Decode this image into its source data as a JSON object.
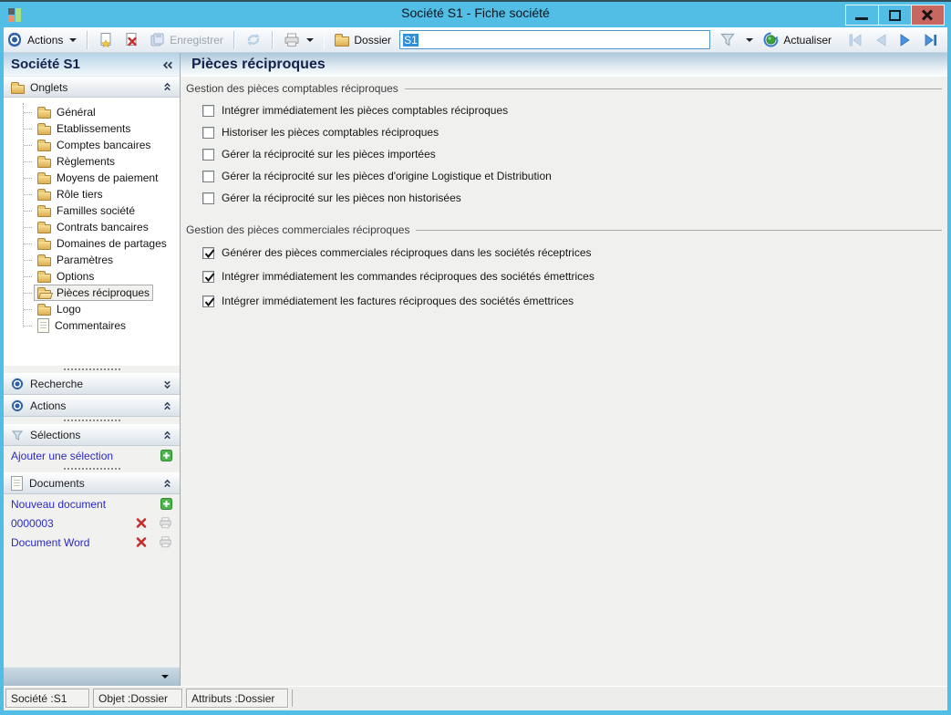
{
  "window": {
    "title": "Société S1 -  Fiche société"
  },
  "toolbar": {
    "actions_label": "Actions",
    "enregistrer_label": "Enregistrer",
    "dossier_label": "Dossier",
    "dossier_value": "S1",
    "actualiser_label": "Actualiser"
  },
  "sidebar": {
    "title": "Société S1",
    "onglets_label": "Onglets",
    "tree": [
      {
        "label": "Général",
        "selected": false
      },
      {
        "label": "Etablissements",
        "selected": false
      },
      {
        "label": "Comptes bancaires",
        "selected": false
      },
      {
        "label": "Règlements",
        "selected": false
      },
      {
        "label": "Moyens de paiement",
        "selected": false
      },
      {
        "label": "Rôle tiers",
        "selected": false
      },
      {
        "label": "Familles société",
        "selected": false
      },
      {
        "label": "Contrats bancaires",
        "selected": false
      },
      {
        "label": "Domaines de partages",
        "selected": false
      },
      {
        "label": "Paramètres",
        "selected": false
      },
      {
        "label": "Options",
        "selected": false
      },
      {
        "label": "Pièces réciproques",
        "selected": true
      },
      {
        "label": "Logo",
        "selected": false
      },
      {
        "label": "Commentaires",
        "selected": false
      }
    ],
    "panels": {
      "recherche_label": "Recherche",
      "actions_label": "Actions",
      "selections_label": "Sélections",
      "documents_label": "Documents"
    },
    "selections": {
      "add_label": "Ajouter une sélection"
    },
    "documents": {
      "new_label": "Nouveau document",
      "items": [
        {
          "label": "0000003"
        },
        {
          "label": "Document Word"
        }
      ]
    }
  },
  "main": {
    "title": "Pièces réciproques",
    "groups": [
      {
        "label": "Gestion des pièces comptables réciproques",
        "items": [
          {
            "label": "Intégrer immédiatement les pièces comptables réciproques",
            "checked": false
          },
          {
            "label": "Historiser les pièces comptables réciproques",
            "checked": false
          },
          {
            "label": "Gérer la réciprocité sur les pièces importées",
            "checked": false
          },
          {
            "label": "Gérer la réciprocité sur les pièces d'origine Logistique et Distribution",
            "checked": false
          },
          {
            "label": "Gérer la réciprocité sur les pièces non historisées",
            "checked": false
          }
        ]
      },
      {
        "label": "Gestion des pièces commerciales réciproques",
        "items": [
          {
            "label": "Générer des pièces commerciales réciproques dans les sociétés réceptrices",
            "checked": true
          },
          {
            "label": "Intégrer immédiatement les commandes réciproques des sociétés émettrices",
            "checked": true
          },
          {
            "label": "Intégrer immédiatement les factures réciproques des sociétés émettrices",
            "checked": true
          }
        ]
      }
    ]
  },
  "statusbar": {
    "cells": [
      "Société :S1",
      "Objet :Dossier",
      "Attributs :Dossier"
    ]
  },
  "colors": {
    "titlebar_blue": "#52BEE6",
    "close_button_red": "#C7675F",
    "link_blue": "#2A2AC2",
    "text_selection_blue": "#2F8FDB",
    "header_navy_text": "#12224A"
  }
}
